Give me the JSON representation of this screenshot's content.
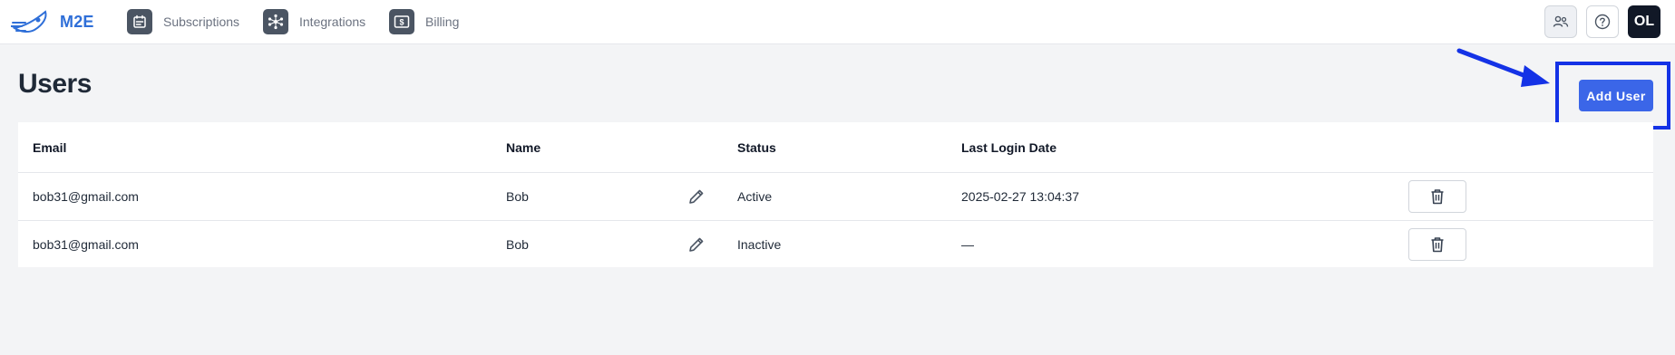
{
  "app": {
    "logo_text": "M2E",
    "logo_icon": "rocket-icon"
  },
  "nav": {
    "items": [
      {
        "label": "Subscriptions",
        "icon": "calendar-list-icon"
      },
      {
        "label": "Integrations",
        "icon": "hub-network-icon"
      },
      {
        "label": "Billing",
        "icon": "dollar-bill-icon"
      }
    ]
  },
  "top_actions": {
    "users_icon": "users-icon",
    "help_icon": "help-circle-icon",
    "avatar_initials": "OL"
  },
  "page": {
    "title": "Users",
    "add_user_label": "Add User"
  },
  "table": {
    "columns": [
      "Email",
      "Name",
      "Status",
      "Last Login Date"
    ],
    "rows": [
      {
        "email": "bob31@gmail.com",
        "name": "Bob",
        "status": "Active",
        "last_login": "2025-02-27 13:04:37"
      },
      {
        "email": "bob31@gmail.com",
        "name": "Bob",
        "status": "Inactive",
        "last_login": "—"
      }
    ]
  },
  "colors": {
    "accent": "#3b66e8",
    "highlight": "#1432e6",
    "logo": "#2f6fd8",
    "avatar_bg": "#111827"
  }
}
